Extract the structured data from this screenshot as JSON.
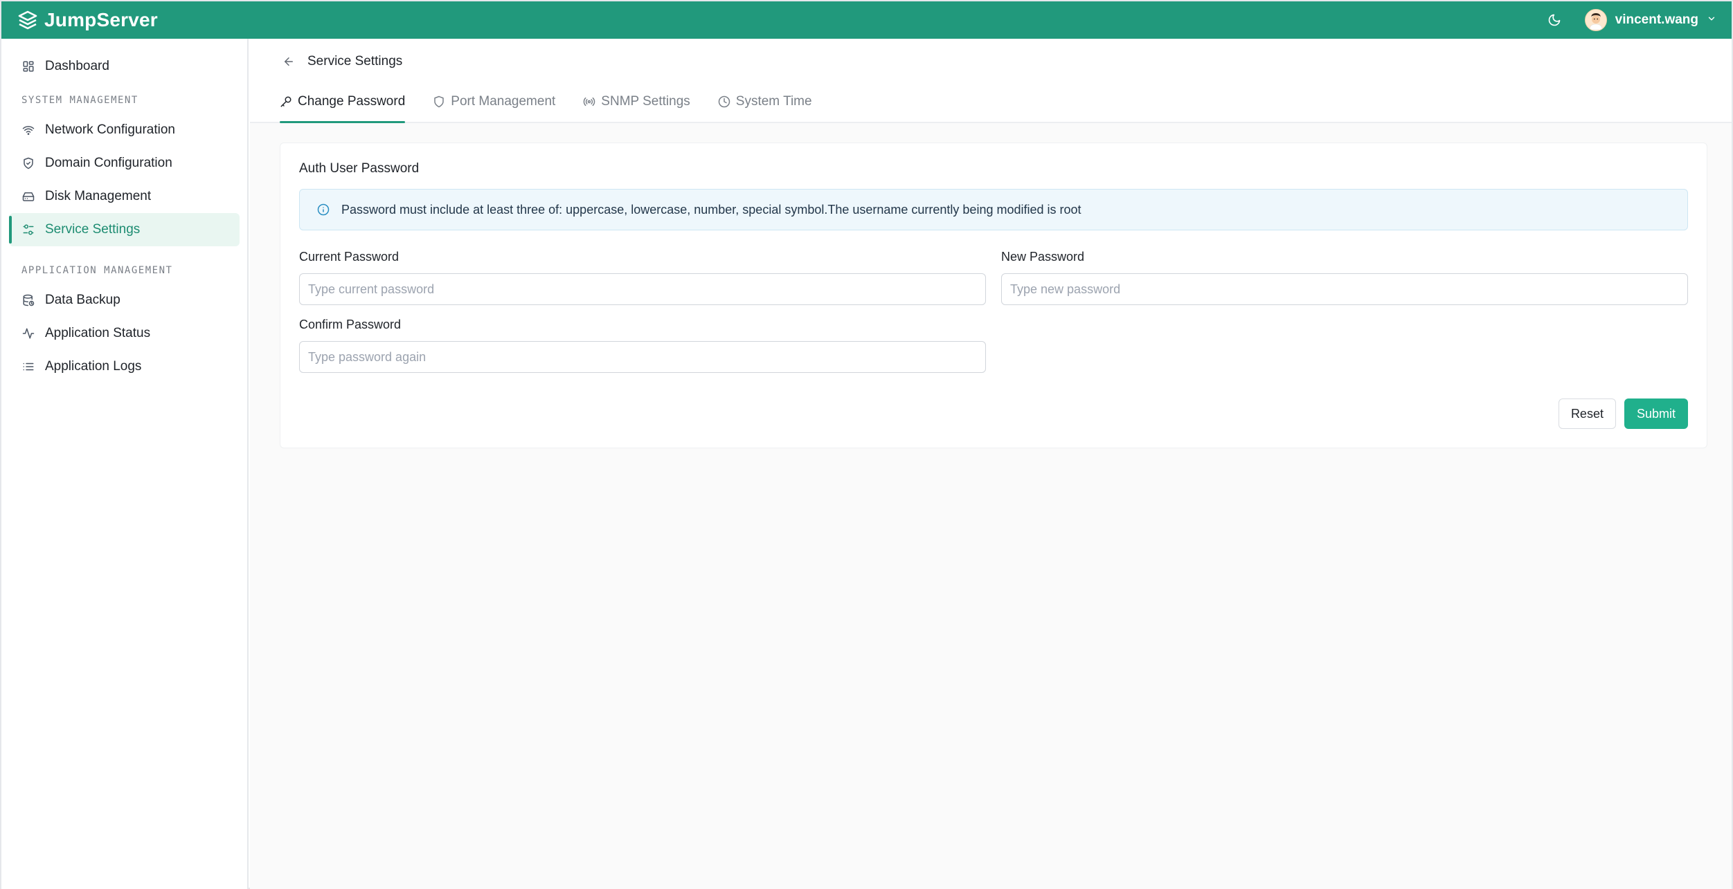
{
  "app": {
    "brand_name": "JumpServer"
  },
  "topbar": {
    "theme_icon": "moon-icon",
    "username": "vincent.wang"
  },
  "sidebar": {
    "dashboard": {
      "label": "Dashboard",
      "icon": "dashboard-icon"
    },
    "sections": [
      {
        "title": "SYSTEM MANAGEMENT",
        "items": [
          {
            "label": "Network Configuration",
            "icon": "wifi-icon"
          },
          {
            "label": "Domain Configuration",
            "icon": "shield-check-icon"
          },
          {
            "label": "Disk Management",
            "icon": "hard-drive-icon"
          },
          {
            "label": "Service Settings",
            "icon": "settings-sliders-icon",
            "active": true
          }
        ]
      },
      {
        "title": "APPLICATION MANAGEMENT",
        "items": [
          {
            "label": "Data Backup",
            "icon": "database-backup-icon"
          },
          {
            "label": "Application Status",
            "icon": "activity-icon"
          },
          {
            "label": "Application Logs",
            "icon": "list-icon"
          }
        ]
      }
    ]
  },
  "page": {
    "title": "Service Settings",
    "tabs": [
      {
        "label": "Change Password",
        "icon": "key-icon",
        "active": true
      },
      {
        "label": "Port Management",
        "icon": "shield-icon"
      },
      {
        "label": "SNMP Settings",
        "icon": "antenna-icon"
      },
      {
        "label": "System Time",
        "icon": "clock-icon"
      }
    ]
  },
  "form": {
    "title": "Auth User Password",
    "alert": "Password must include at least three of: uppercase, lowercase, number, special symbol.The username currently being modified is root",
    "current_password": {
      "label": "Current Password",
      "placeholder": "Type current password",
      "value": ""
    },
    "new_password": {
      "label": "New Password",
      "placeholder": "Type new password",
      "value": ""
    },
    "confirm_password": {
      "label": "Confirm Password",
      "placeholder": "Type password again",
      "value": ""
    },
    "reset_label": "Reset",
    "submit_label": "Submit"
  },
  "colors": {
    "brand": "#21997c",
    "submit": "#20b08c",
    "active_bg": "#e9f6f1"
  }
}
